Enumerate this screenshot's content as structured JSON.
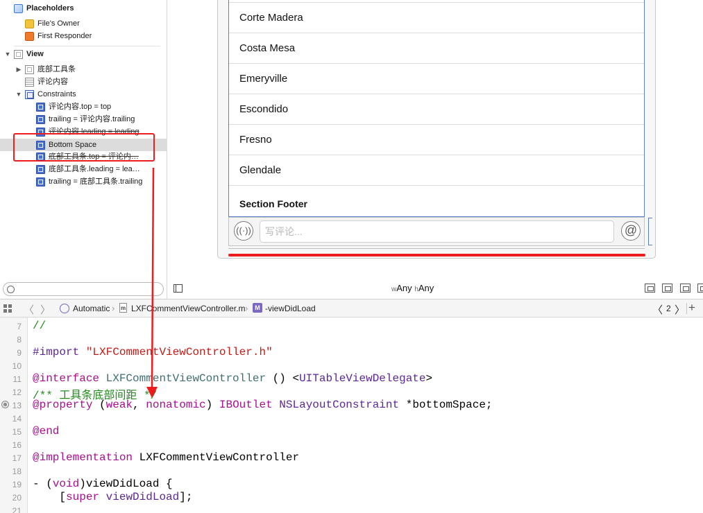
{
  "outline": {
    "placeholders_label": "Placeholders",
    "files_owner_label": "File's Owner",
    "first_responder_label": "First Responder",
    "view_label": "View",
    "toolbar_label": "底部工具条",
    "comment_label": "评论内容",
    "constraints_label": "Constraints",
    "constraints": [
      "评论内容.top = top",
      "trailing = 评论内容.trailing",
      "评论内容.leading = leading",
      "Bottom Space",
      "底部工具条.top = 评论内…",
      "底部工具条.leading = lea…",
      "trailing = 底部工具条.trailing"
    ],
    "selected_constraint": "Bottom Space"
  },
  "canvas": {
    "cells": [
      "Corte Madera",
      "Costa Mesa",
      "Emeryville",
      "Escondido",
      "Fresno",
      "Glendale"
    ],
    "section_footer": "Section Footer",
    "comment_placeholder": "写评论...",
    "voice_icon_glyph": "((·))",
    "at_icon_glyph": "@",
    "size_class": {
      "w_prefix": "w",
      "w_value": "Any",
      "h_prefix": "h",
      "h_value": "Any"
    }
  },
  "jumpbar": {
    "scheme": "Automatic",
    "file_badge": "m",
    "file_name": "LXFCommentViewController.m",
    "method_badge": "M",
    "method_name": "-viewDidLoad",
    "counter": "2"
  },
  "editor": {
    "line_numbers": [
      "7",
      "8",
      "9",
      "10",
      "11",
      "12",
      "13",
      "14",
      "15",
      "16",
      "17",
      "18",
      "19",
      "20",
      "21"
    ],
    "lines": {
      "l7": "//",
      "l9_kw": "#import",
      "l9_str": "\"LXFCommentViewController.h\"",
      "l11_kw": "@interface",
      "l11_cls": "LXFCommentViewController",
      "l11_mid": " () <",
      "l11_proto": "UITableViewDelegate",
      "l11_end": ">",
      "l12_comment": "/** 工具条底部间距 */",
      "l13_kw": "@property",
      "l13_p1": " (",
      "l13_weak": "weak",
      "l13_p2": ", ",
      "l13_nonatomic": "nonatomic",
      "l13_p3": ") ",
      "l13_iboutlet": "IBOutlet",
      "l13_sp": " ",
      "l13_type": "NSLayoutConstraint",
      "l13_var": " *bottomSpace;",
      "l15_kw": "@end",
      "l17_kw": "@implementation",
      "l17_name": " LXFCommentViewController",
      "l19_a": "- (",
      "l19_void": "void",
      "l19_b": ")viewDidLoad {",
      "l20_a": "    [",
      "l20_super": "super",
      "l20_sp": " ",
      "l20_method": "viewDidLoad",
      "l20_end": "];"
    }
  },
  "colors": {
    "highlight": "#ee1c1c",
    "selection_blue": "#5b7ec9",
    "comment_green": "#1f8c1a",
    "keyword_purple": "#aa0d91",
    "string_red": "#c41a16"
  }
}
